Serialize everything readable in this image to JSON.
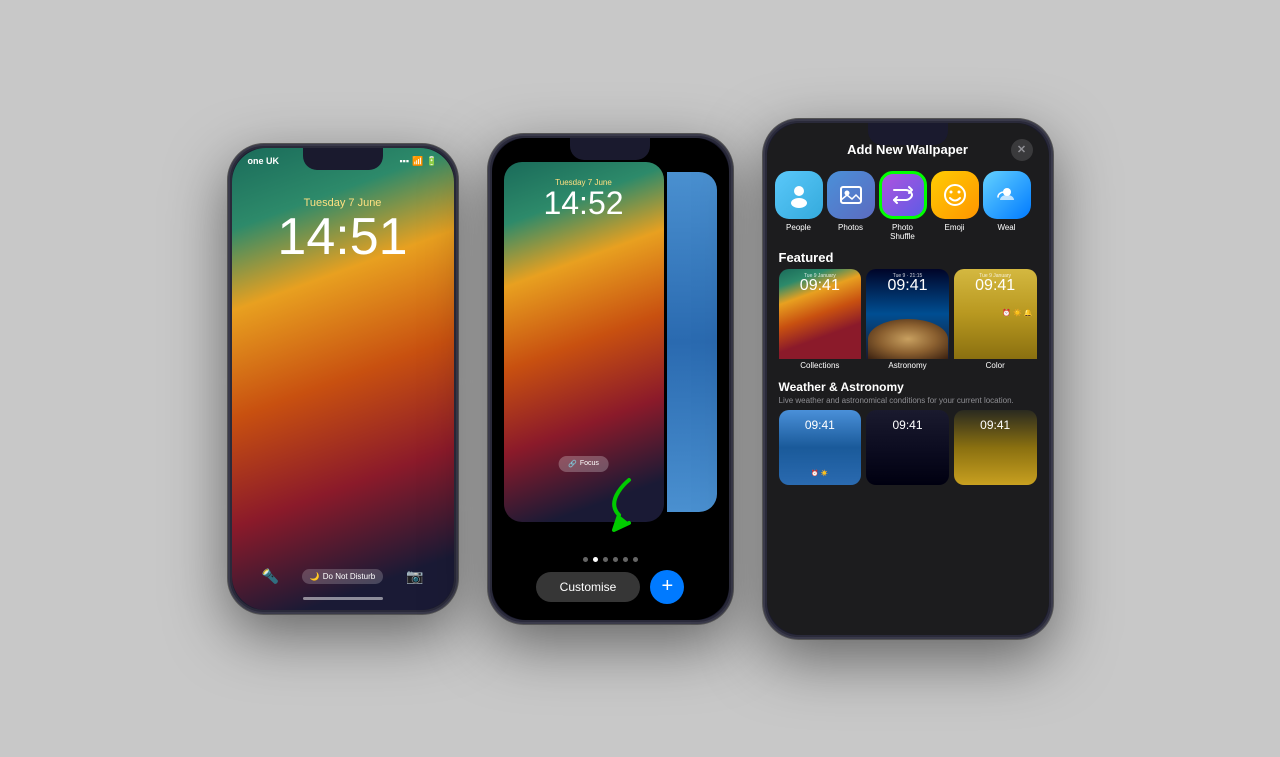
{
  "phones": {
    "phone1": {
      "status": {
        "carrier": "one UK",
        "time": "14:51",
        "signal_icon": "📶",
        "wifi_icon": "📡",
        "battery_icon": "🔋"
      },
      "date": "Tuesday 7 June",
      "time": "14:51",
      "bottom": {
        "torch_icon": "🔦",
        "dnd_label": "Do Not Disturb",
        "moon_icon": "🌙",
        "camera_icon": "📷"
      },
      "home_indicator": true
    },
    "phone2": {
      "status": {
        "time": "14:52"
      },
      "date": "Tuesday 7 June",
      "time": "14:52",
      "focus_label": "Focus",
      "dots": [
        "",
        "",
        "",
        "",
        "",
        ""
      ],
      "customise_label": "Customise",
      "add_icon": "+"
    },
    "phone3": {
      "header": {
        "title": "Add New Wallpaper",
        "close_icon": "✕"
      },
      "types": [
        {
          "id": "people",
          "label": "People",
          "icon": "👤"
        },
        {
          "id": "photos",
          "label": "Photos",
          "icon": "🖼"
        },
        {
          "id": "shuffle",
          "label": "Photo\nShuffle",
          "icon": "⇄",
          "selected": true
        },
        {
          "id": "emoji",
          "label": "Emoji",
          "icon": "😊"
        },
        {
          "id": "weather",
          "label": "Weal",
          "icon": "🌤"
        }
      ],
      "featured": {
        "title": "Featured",
        "items": [
          {
            "id": "collections",
            "time": "09:41",
            "label": "Collections"
          },
          {
            "id": "astronomy",
            "time": "09:41",
            "label": "Astronomy"
          },
          {
            "id": "color",
            "time": "09:41",
            "label": "Color"
          }
        ]
      },
      "weather_section": {
        "title": "Weather & Astronomy",
        "description": "Live weather and astronomical conditions for your current location.",
        "items": [
          {
            "id": "w1",
            "time": "09:41"
          },
          {
            "id": "w2",
            "time": "09:41"
          },
          {
            "id": "w3",
            "time": "09:41"
          }
        ]
      }
    }
  },
  "arrow": {
    "color": "#00cc00"
  }
}
